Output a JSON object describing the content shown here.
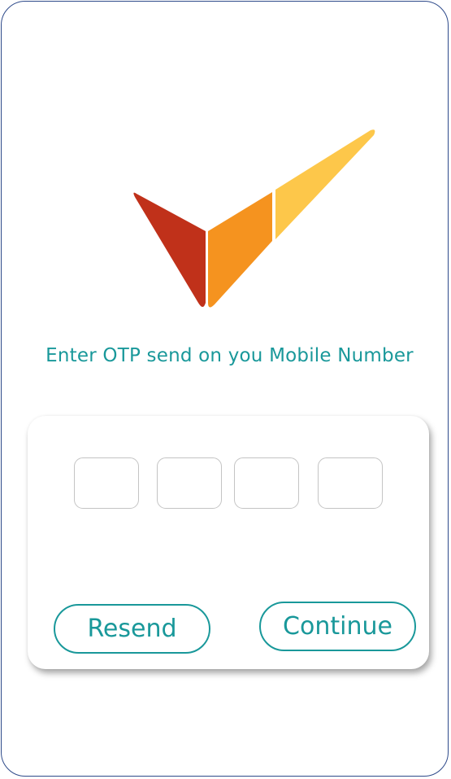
{
  "brand": {
    "logo_icon": "checkmark-logo-icon",
    "colors": {
      "red": "#c0311a",
      "orange": "#f5931f",
      "yellow": "#fdc74a",
      "accent": "#19989a",
      "frame": "#2e4a8a"
    }
  },
  "otp": {
    "instruction": "Enter OTP send on you Mobile Number",
    "digits": [
      "",
      "",
      "",
      ""
    ]
  },
  "actions": {
    "resend_label": "Resend",
    "continue_label": "Continue"
  }
}
